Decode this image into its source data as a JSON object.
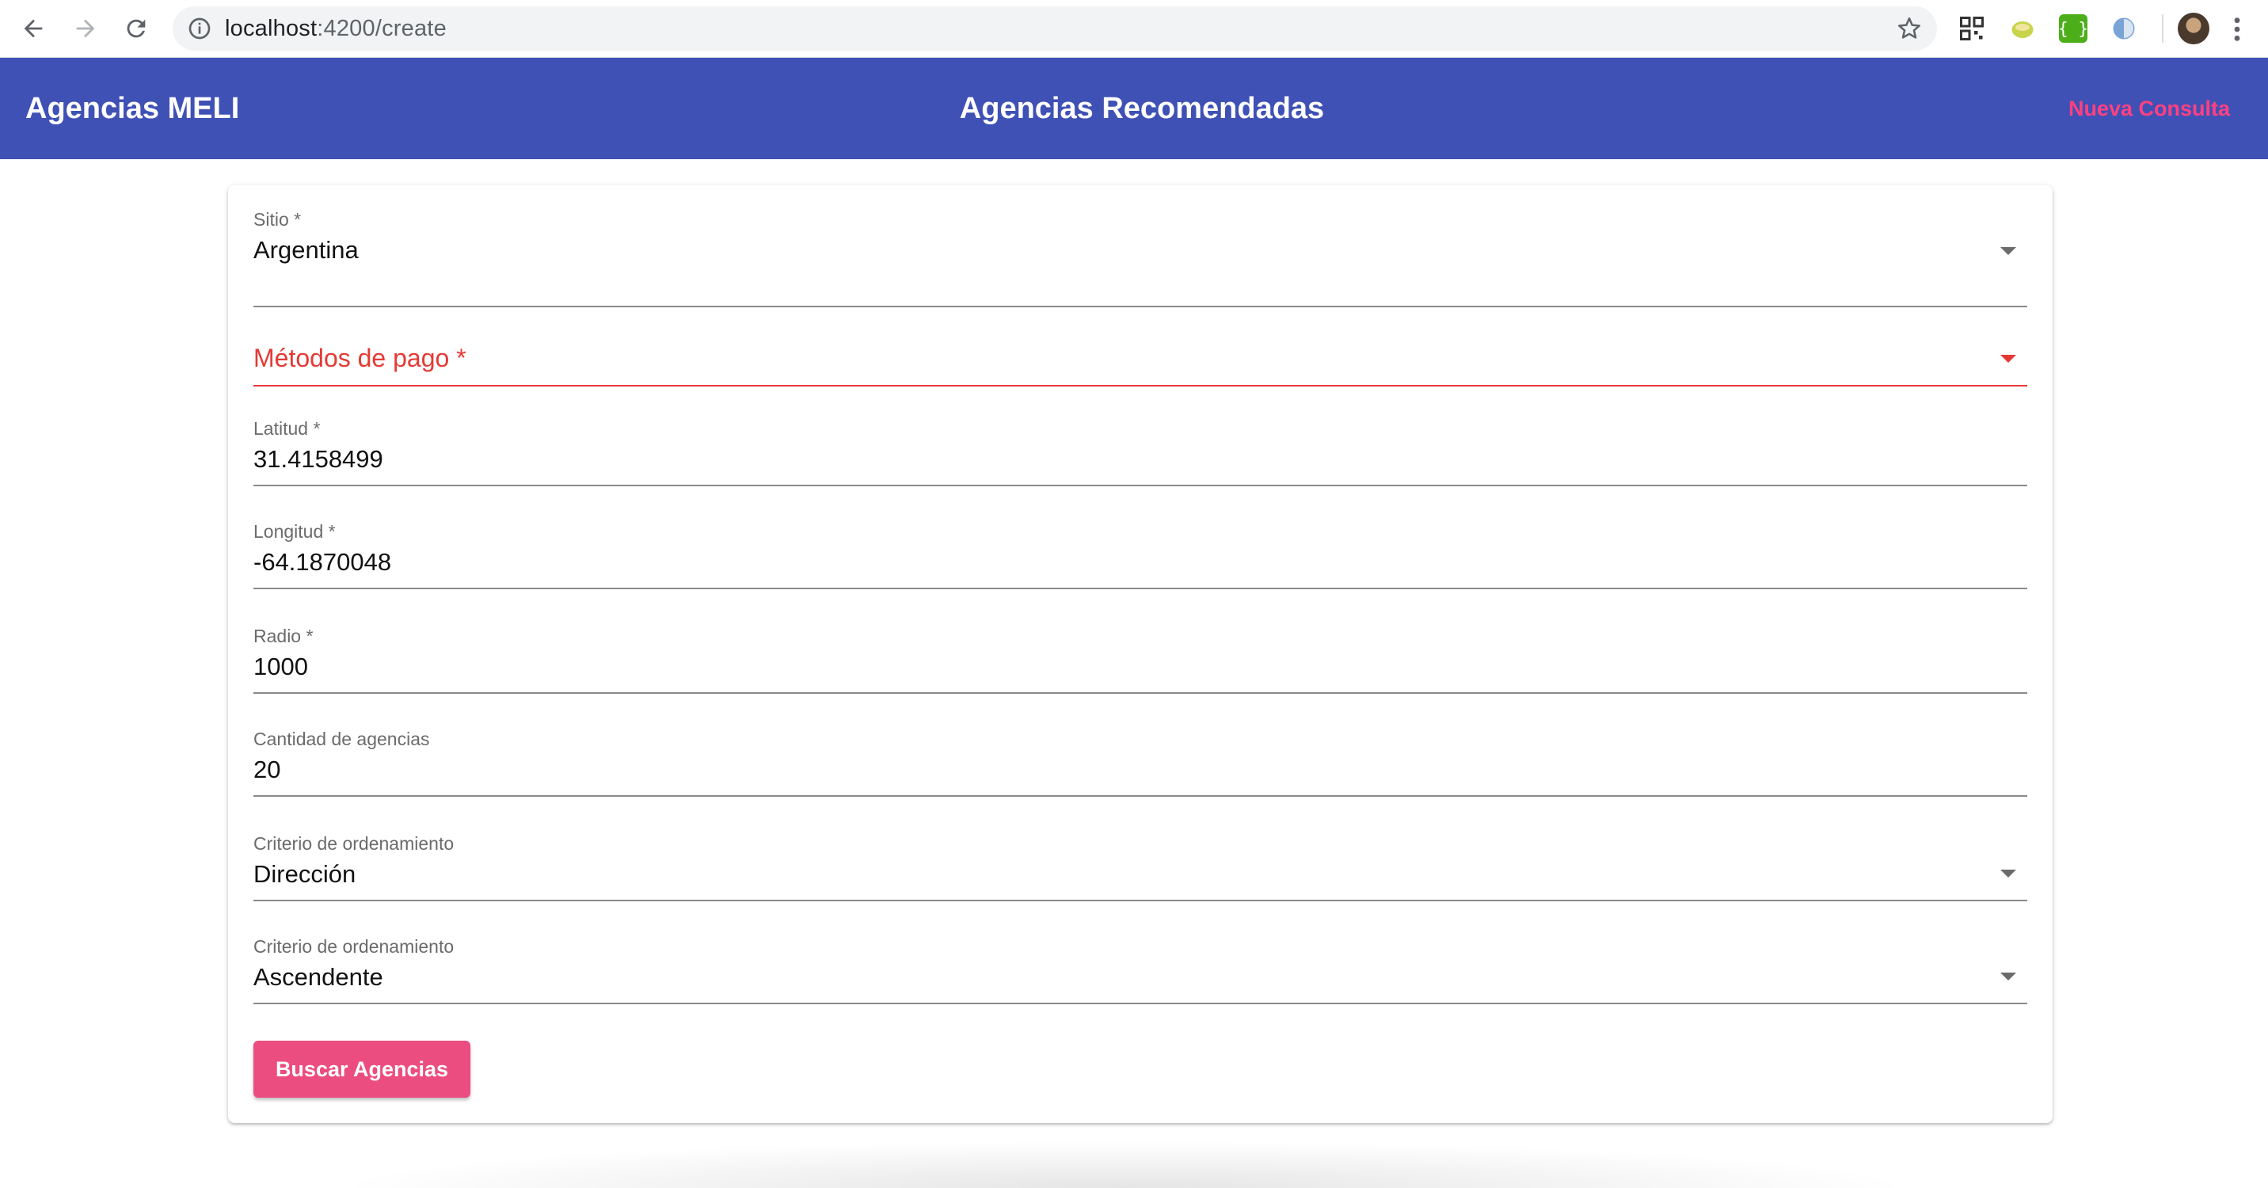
{
  "browser": {
    "url_host": "localhost",
    "url_path": ":4200/create",
    "icons": [
      "back-icon",
      "forward-icon",
      "reload-icon",
      "info-icon",
      "star-icon",
      "qr-extension-icon",
      "extension-icon",
      "json-extension-icon",
      "shield-extension-icon",
      "avatar",
      "menu-kebab-icon"
    ]
  },
  "toolbar": {
    "brand": "Agencias MELI",
    "title": "Agencias Recomendadas",
    "new_query": "Nueva Consulta",
    "color": "#3f51b5",
    "accent": "#ff4081"
  },
  "form": {
    "sitio": {
      "label": "Sitio *",
      "value": "Argentina"
    },
    "metodos_pago": {
      "placeholder": "Métodos de pago *",
      "error_color": "#e53935"
    },
    "latitud": {
      "label": "Latitud *",
      "value": "31.4158499"
    },
    "longitud": {
      "label": "Longitud *",
      "value": "-64.1870048"
    },
    "radio": {
      "label": "Radio *",
      "value": "1000"
    },
    "cantidad": {
      "label": "Cantidad de agencias",
      "value": "20"
    },
    "criterio1": {
      "label": "Criterio de ordenamiento",
      "value": "Dirección"
    },
    "criterio2": {
      "label": "Criterio de ordenamiento",
      "value": "Ascendente"
    },
    "submit_label": "Buscar Agencias",
    "submit_color": "#ec4d80"
  }
}
